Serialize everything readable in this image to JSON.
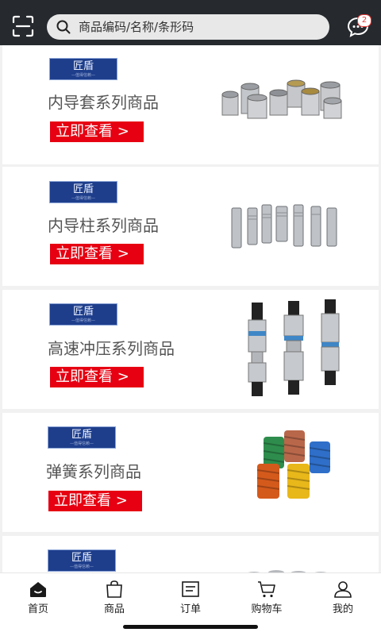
{
  "search": {
    "placeholder": "商品编码/名称/条形码"
  },
  "header": {
    "message_badge": "2"
  },
  "brand": {
    "name": "匠盾",
    "tagline": "—值得信赖—"
  },
  "categories": [
    {
      "title": "内导套系列商品",
      "cta": "立即查看 >"
    },
    {
      "title": "内导柱系列商品",
      "cta": "立即查看 >"
    },
    {
      "title": "高速冲压系列商品",
      "cta": "立即查看 >"
    },
    {
      "title": "弹簧系列商品",
      "cta": "立即查看 >"
    },
    {
      "title": "",
      "cta": ""
    }
  ],
  "tabs": [
    {
      "label": "首页",
      "icon": "home-icon"
    },
    {
      "label": "商品",
      "icon": "bag-icon"
    },
    {
      "label": "订单",
      "icon": "order-icon"
    },
    {
      "label": "购物车",
      "icon": "cart-icon"
    },
    {
      "label": "我的",
      "icon": "user-icon"
    }
  ],
  "colors": {
    "topbar": "#262a2f",
    "cta": "#e60012",
    "brand": "#1e3e8c"
  }
}
